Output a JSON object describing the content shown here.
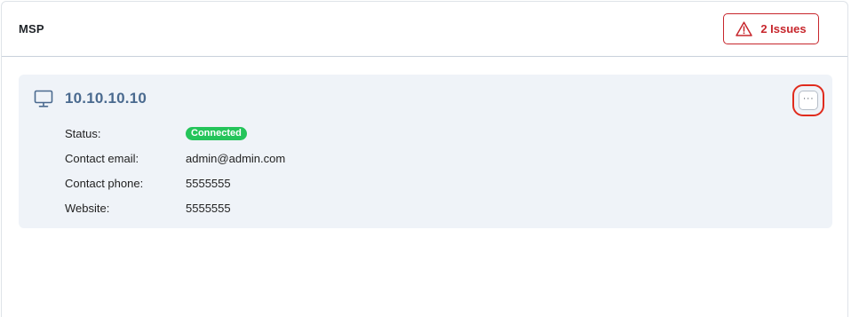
{
  "panel": {
    "title": "MSP",
    "issues_button": {
      "icon": "warning-triangle-icon",
      "label": "2 Issues",
      "color": "#c7262c"
    }
  },
  "card": {
    "icon": "monitor-icon",
    "title": "10.10.10.10",
    "menu_button": {
      "icon": "ellipsis-icon",
      "label": "···",
      "highlighted": true
    },
    "details": [
      {
        "label": "Status:",
        "value": "Connected",
        "type": "badge",
        "color": "#24c45a"
      },
      {
        "label": "Contact email:",
        "value": "admin@admin.com",
        "type": "text"
      },
      {
        "label": "Contact phone:",
        "value": "5555555",
        "type": "text"
      },
      {
        "label": "Website:",
        "value": "5555555",
        "type": "text"
      }
    ]
  }
}
